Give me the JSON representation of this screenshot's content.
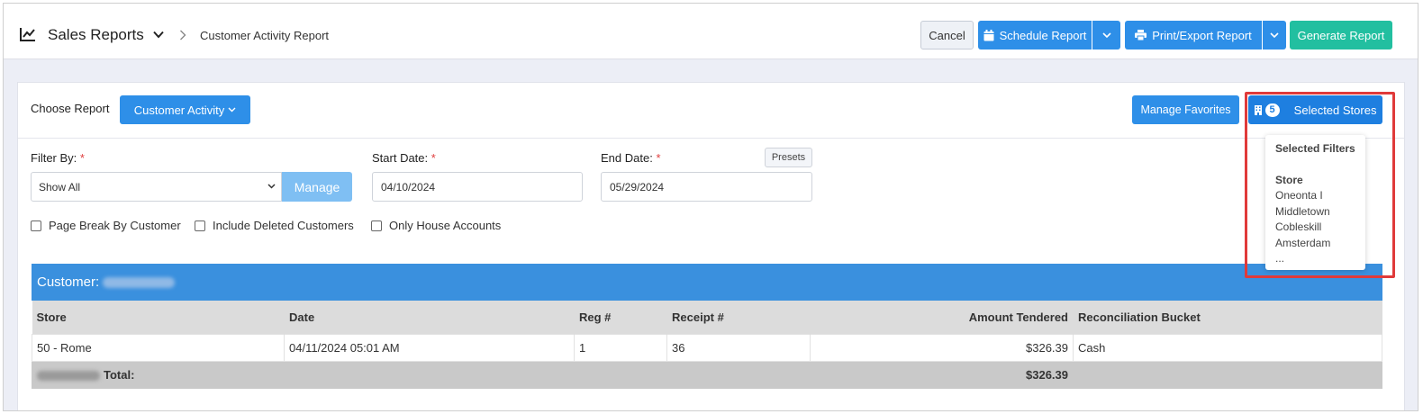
{
  "header": {
    "title": "Sales Reports",
    "breadcrumb": "Customer Activity Report",
    "cancel": "Cancel",
    "schedule": "Schedule Report",
    "print": "Print/Export Report",
    "generate": "Generate Report"
  },
  "report": {
    "choose_label": "Choose Report",
    "selected": "Customer Activity",
    "manage_favorites": "Manage Favorites",
    "stores_count": "5",
    "stores_label": "Selected Stores"
  },
  "filters": {
    "filter_by_label": "Filter By:",
    "filter_by_value": "Show All",
    "manage": "Manage",
    "start_label": "Start Date:",
    "start_value": "04/10/2024",
    "end_label": "End Date:",
    "end_value": "05/29/2024",
    "presets": "Presets",
    "required_mark": "*"
  },
  "checkboxes": [
    {
      "label": "Page Break By Customer",
      "checked": false
    },
    {
      "label": "Include Deleted Customers",
      "checked": false
    },
    {
      "label": "Only House Accounts",
      "checked": false
    }
  ],
  "table": {
    "customer_label": "Customer:",
    "columns": [
      "Store",
      "Date",
      "Reg #",
      "Receipt #",
      "Amount Tendered",
      "Reconciliation Bucket"
    ],
    "rows": [
      [
        "50 - Rome",
        "04/11/2024 05:01 AM",
        "1",
        "36",
        "$326.39",
        "Cash"
      ]
    ],
    "total_label": "Total:",
    "total_amount": "$326.39"
  },
  "popover": {
    "heading": "Selected Filters",
    "subheading": "Store",
    "items": [
      "Oneonta I",
      "Middletown",
      "Cobleskill",
      "Amsterdam",
      "..."
    ]
  },
  "colors": {
    "primary": "#2e8fe8",
    "generate": "#22bfa0",
    "customer_bar": "#3a90de",
    "highlight": "#e03a3a"
  }
}
